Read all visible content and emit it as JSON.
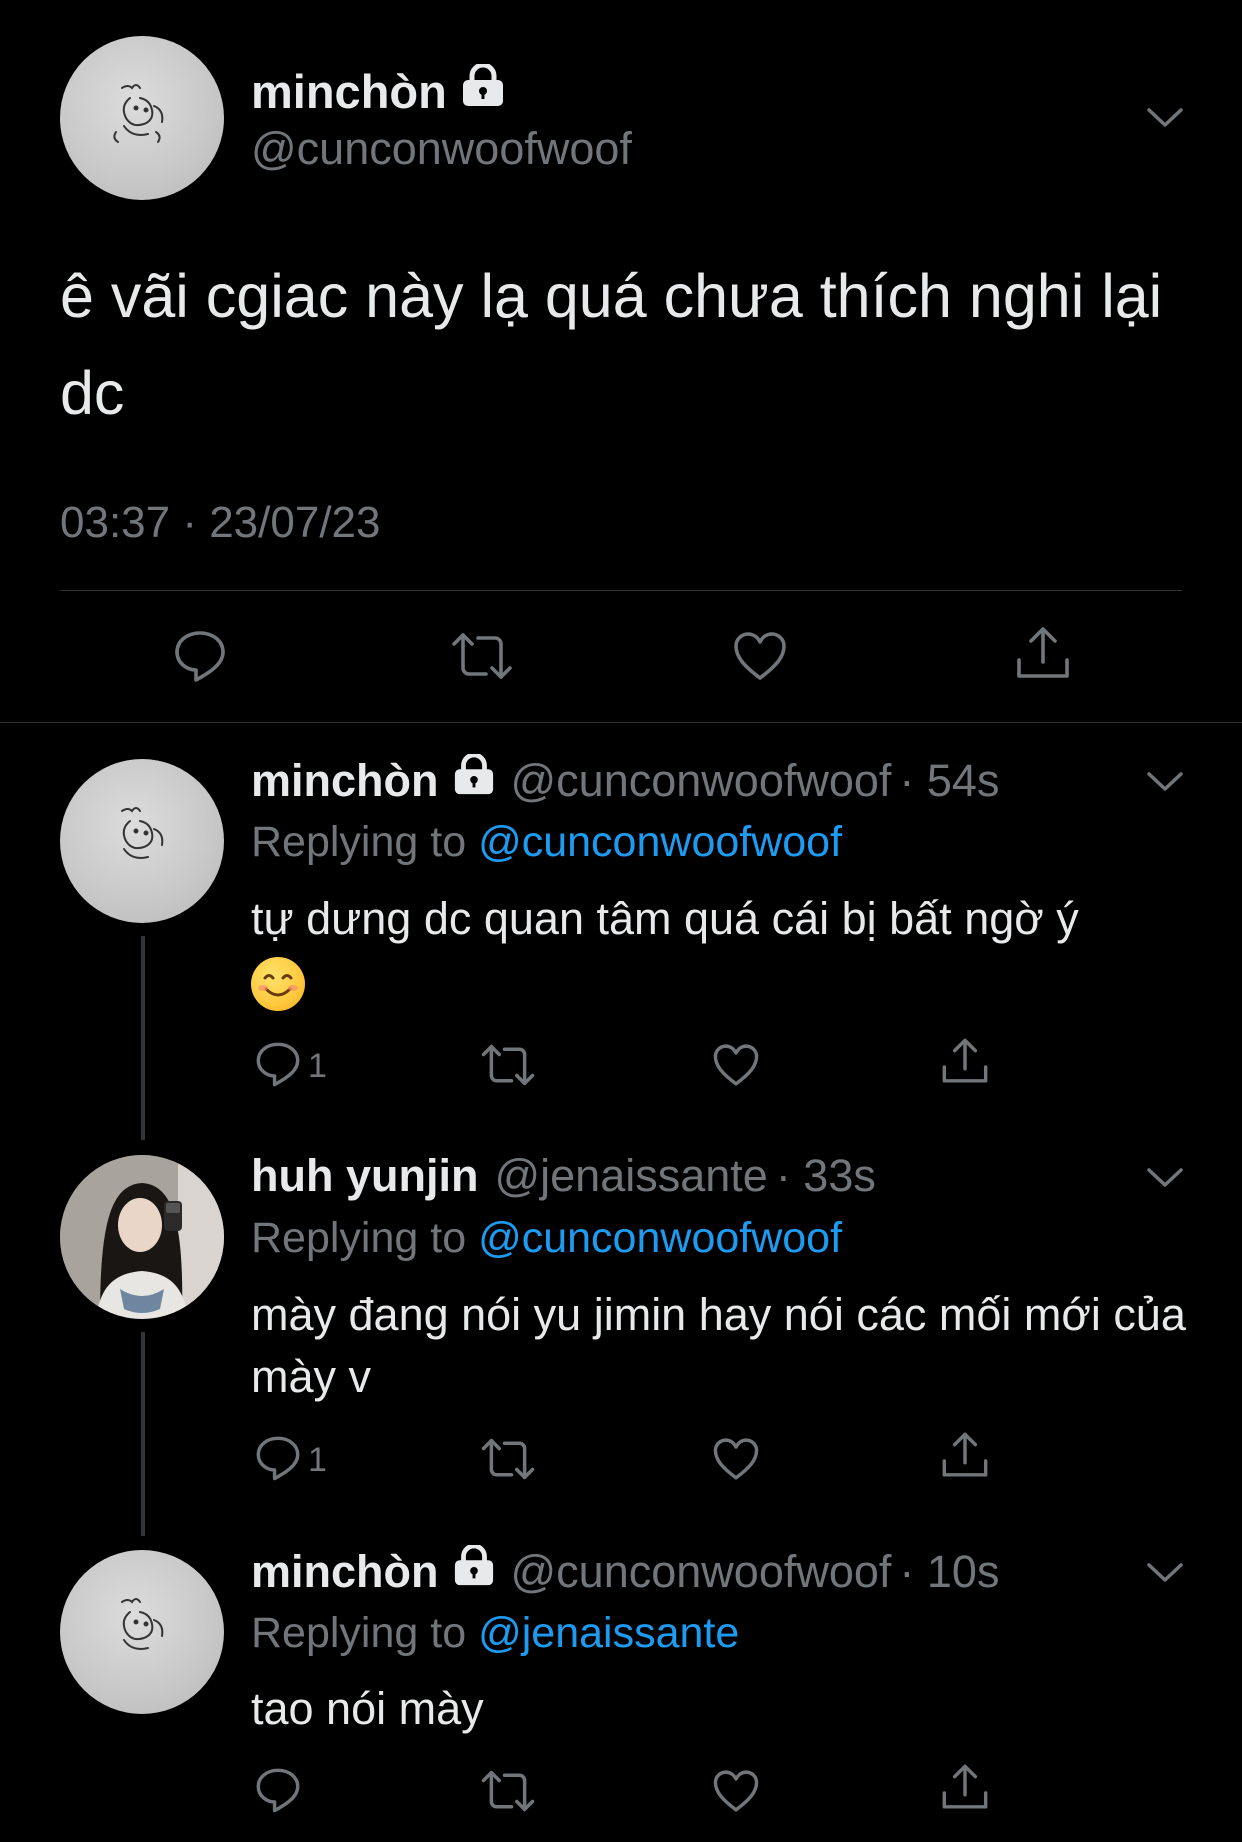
{
  "main_tweet": {
    "name": "minchòn",
    "handle": "@cunconwoofwoof",
    "text": "ê vãi cgiac này lạ quá chưa thích nghi lại dc",
    "timestamp": "03:37 · 23/07/23"
  },
  "replies": [
    {
      "name": "minchòn",
      "handle": "@cunconwoofwoof",
      "time": "· 54s",
      "replying_label": "Replying to ",
      "replying_to": "@cunconwoofwoof",
      "text": "tự dưng dc quan tâm quá cái bị bất ngờ ý",
      "reply_count": "1",
      "locked": true,
      "avatar": "sketch"
    },
    {
      "name": "huh yunjin",
      "handle": "@jenaissante",
      "time": "· 33s",
      "replying_label": "Replying to ",
      "replying_to": "@cunconwoofwoof",
      "text": "mày đang nói yu jimin hay nói các mối mới của mày v",
      "reply_count": "1",
      "locked": false,
      "avatar": "photo"
    },
    {
      "name": "minchòn",
      "handle": "@cunconwoofwoof",
      "time": "· 10s",
      "replying_label": "Replying to ",
      "replying_to": "@jenaissante",
      "text": "tao nói mày",
      "reply_count": "",
      "locked": true,
      "avatar": "sketch"
    }
  ],
  "icons": {
    "reply": "speech-bubble-icon",
    "retweet": "retweet-icon",
    "like": "heart-icon",
    "share": "share-icon",
    "lock": "lock-icon",
    "chevron": "chevron-down-icon"
  },
  "colors": {
    "background": "#000000",
    "text": "#e7e9ea",
    "secondary": "#71767b",
    "link": "#1d9bf0",
    "divider": "#2f3336"
  }
}
